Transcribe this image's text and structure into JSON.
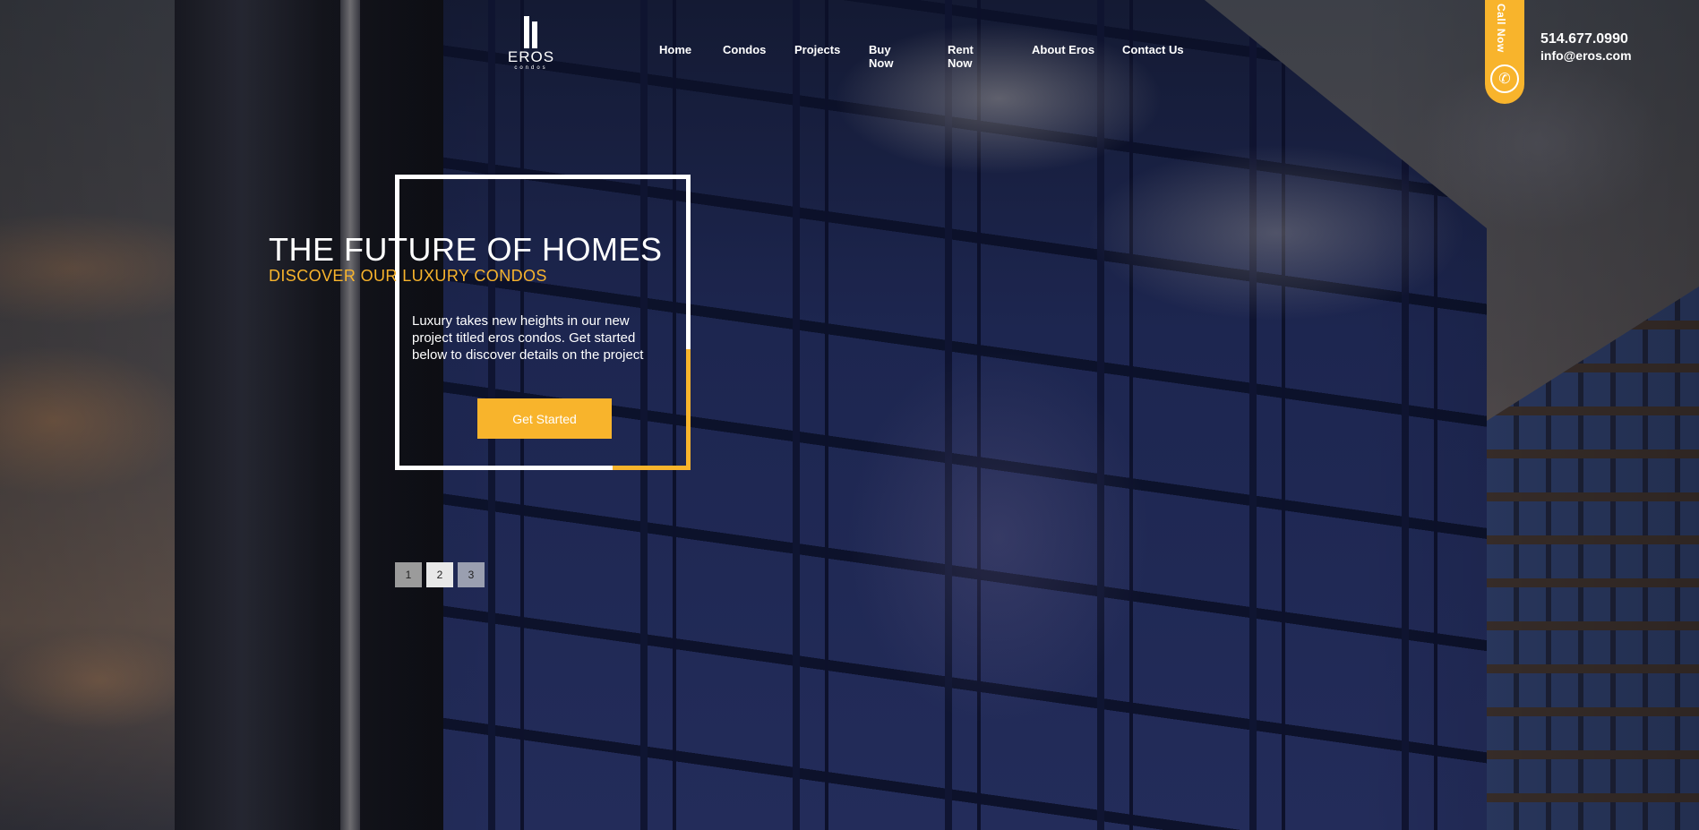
{
  "logo": {
    "word": "EROS",
    "sub": "condos"
  },
  "nav": {
    "items": [
      {
        "label": "Home"
      },
      {
        "label": "Condos"
      },
      {
        "label": "Projects"
      },
      {
        "label": "Buy Now"
      },
      {
        "label": "Rent Now"
      },
      {
        "label": "About Eros"
      },
      {
        "label": "Contact Us"
      }
    ]
  },
  "call": {
    "label": "Call Now",
    "icon": "phone-icon"
  },
  "contact": {
    "phone": "514.677.0990",
    "email": "info@eros.com"
  },
  "hero": {
    "title": "THE FUTURE OF HOMES",
    "subtitle": "DISCOVER OUR LUXURY CONDOS",
    "text": "Luxury takes new heights in our new project titled eros condos. Get started below to discover details on the project",
    "cta": "Get Started"
  },
  "pager": {
    "pages": [
      "1",
      "2",
      "3"
    ],
    "active": "2"
  },
  "colors": {
    "accent": "#f8b42c",
    "text": "#ffffff"
  }
}
